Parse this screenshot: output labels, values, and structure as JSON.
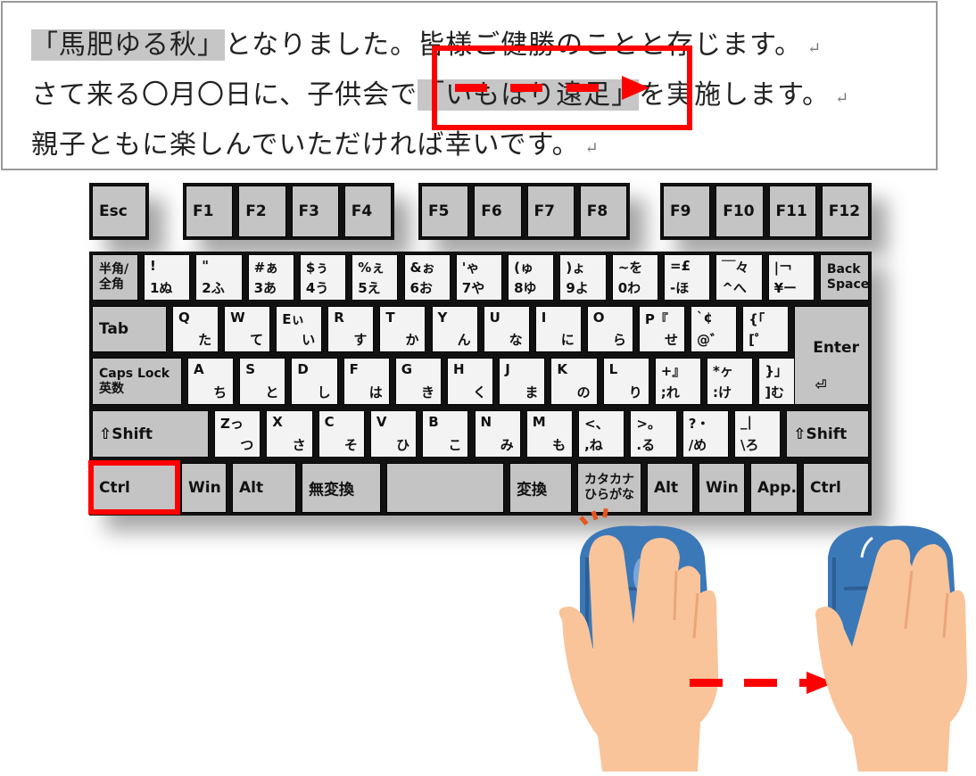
{
  "document": {
    "lines": [
      {
        "highlight": "「馬肥ゆる秋」",
        "rest": "となりました。皆様ご健勝のことと存じます。"
      },
      {
        "before": "さて来る〇月〇日に、子供会で",
        "highlight": "「いもほり遠足」",
        "rest": "を実施します。"
      },
      {
        "text": "親子ともに楽しんでいただければ幸いです。"
      }
    ],
    "paragraph_mark": "↵",
    "accent_color": "#ff0000",
    "highlight_color": "#c6c6c6"
  },
  "keyboard": {
    "function_row": [
      "Esc",
      "F1",
      "F2",
      "F3",
      "F4",
      "F5",
      "F6",
      "F7",
      "F8",
      "F9",
      "F10",
      "F11",
      "F12"
    ],
    "number_row": {
      "hankaku": [
        "半角/",
        "全角"
      ],
      "keys": [
        {
          "top": "!",
          "bottom": "1ぬ"
        },
        {
          "top": "\"",
          "bottom": "2ふ"
        },
        {
          "top": "#ぁ",
          "bottom": "3あ"
        },
        {
          "top": "$ぅ",
          "bottom": "4う"
        },
        {
          "top": "%ぇ",
          "bottom": "5え"
        },
        {
          "top": "&ぉ",
          "bottom": "6お"
        },
        {
          "top": "'ゃ",
          "bottom": "7や"
        },
        {
          "top": "(ゅ",
          "bottom": "8ゆ"
        },
        {
          "top": ")ょ",
          "bottom": "9よ"
        },
        {
          "top": "~を",
          "bottom": "0わ"
        },
        {
          "top": "=£",
          "bottom": "-ほ"
        },
        {
          "top": "￣々",
          "bottom": "^へ"
        },
        {
          "top": "|￢",
          "bottom": "¥ー"
        }
      ],
      "backspace": [
        "Back",
        "Space"
      ]
    },
    "qwerty_row": {
      "tab": "Tab",
      "keys": [
        {
          "top": "Q",
          "bottom": "た"
        },
        {
          "top": "W",
          "bottom": "て"
        },
        {
          "top": "Eぃ",
          "bottom": "い"
        },
        {
          "top": "R",
          "bottom": "す"
        },
        {
          "top": "T",
          "bottom": "か"
        },
        {
          "top": "Y",
          "bottom": "ん"
        },
        {
          "top": "U",
          "bottom": "な"
        },
        {
          "top": "I",
          "bottom": "に"
        },
        {
          "top": "O",
          "bottom": "ら"
        },
        {
          "top": "P『",
          "bottom": "せ"
        },
        {
          "top": "`¢",
          "bottom": "@゛"
        },
        {
          "top": "{「",
          "bottom": "[゜"
        }
      ],
      "enter": "Enter",
      "enter_arrow": "⏎"
    },
    "home_row": {
      "caps": [
        "Caps Lock",
        "英数"
      ],
      "keys": [
        {
          "top": "A",
          "bottom": "ち"
        },
        {
          "top": "S",
          "bottom": "と"
        },
        {
          "top": "D",
          "bottom": "し"
        },
        {
          "top": "F",
          "bottom": "は"
        },
        {
          "top": "G",
          "bottom": "き"
        },
        {
          "top": "H",
          "bottom": "く"
        },
        {
          "top": "J",
          "bottom": "ま"
        },
        {
          "top": "K",
          "bottom": "の"
        },
        {
          "top": "L",
          "bottom": "り"
        },
        {
          "top": "+』",
          "bottom": ";れ"
        },
        {
          "top": "*ヶ",
          "bottom": ":け"
        },
        {
          "top": "}」",
          "bottom": "]む"
        }
      ]
    },
    "shift_row": {
      "left_shift": "⇧Shift",
      "keys": [
        {
          "top": "Zっ",
          "bottom": "つ"
        },
        {
          "top": "X",
          "bottom": "さ"
        },
        {
          "top": "C",
          "bottom": "そ"
        },
        {
          "top": "V",
          "bottom": "ひ"
        },
        {
          "top": "B",
          "bottom": "こ"
        },
        {
          "top": "N",
          "bottom": "み"
        },
        {
          "top": "M",
          "bottom": "も"
        },
        {
          "top": "<、",
          "bottom": ",ね"
        },
        {
          "top": ">。",
          "bottom": ".る"
        },
        {
          "top": "?・",
          "bottom": "/め"
        },
        {
          "top": "_|",
          "bottom": "\\ろ"
        }
      ],
      "right_shift": "⇧Shift"
    },
    "bottom_row": {
      "ctrl_left": "Ctrl",
      "win_left": "Win",
      "alt_left": "Alt",
      "muhenkan": "無変換",
      "space": "",
      "henkan": "変換",
      "kana": [
        "カタカナ",
        "ひらがな"
      ],
      "alt_right": "Alt",
      "win_right": "Win",
      "app": "App.",
      "ctrl_right": "Ctrl"
    },
    "highlighted_key": "Ctrl"
  },
  "illustration": {
    "left": "hand-on-mouse-clicking",
    "right": "hand-on-mouse-dragging",
    "arrow_direction": "right"
  }
}
